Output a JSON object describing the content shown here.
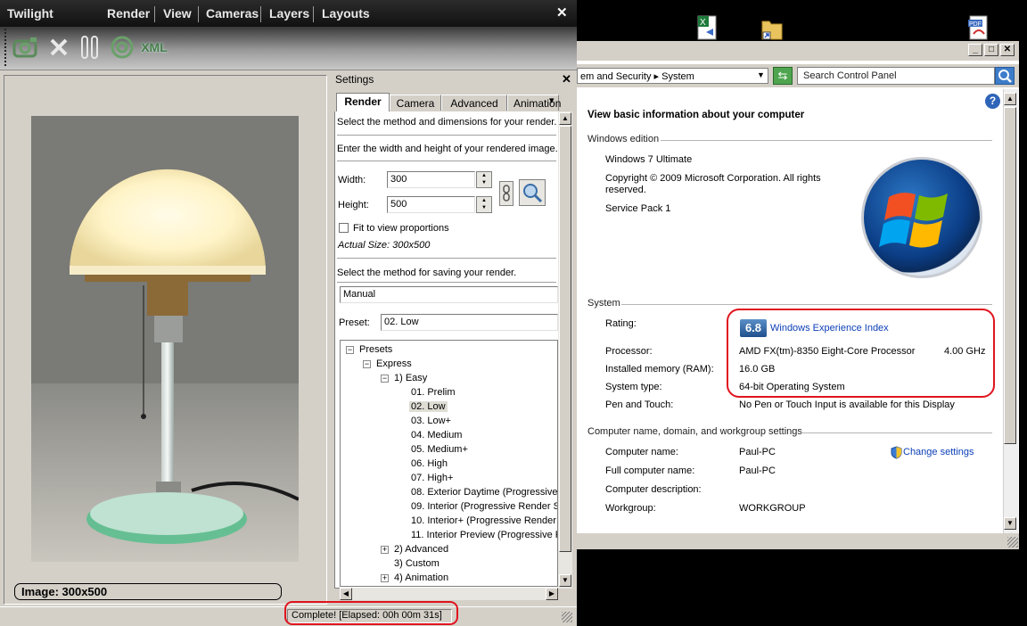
{
  "twilight": {
    "title": "Twilight",
    "menu": [
      "Render",
      "View",
      "Cameras",
      "Layers",
      "Layouts"
    ],
    "close_glyph": "✕",
    "toolbar": [
      {
        "icon": "camera-render-icon"
      },
      {
        "icon": "cancel-x-icon"
      },
      {
        "icon": "pause-icon"
      },
      {
        "icon": "target-icon"
      },
      {
        "icon": "xml-icon",
        "label": "XML"
      }
    ],
    "image_label": "Image: 300x500",
    "status": "Complete!  [Elapsed: 00h 00m 31s]"
  },
  "settings": {
    "title": "Settings",
    "close_glyph": "✕",
    "tabs": [
      "Render",
      "Camera",
      "Advanced",
      "Animation"
    ],
    "tab_arrow": "▾",
    "method_text": "Select the method and dimensions for your render.",
    "dims_text": "Enter the width and height of your rendered image.",
    "width_label": "Width:",
    "width_value": "300",
    "height_label": "Height:",
    "height_value": "500",
    "fit_label": "Fit to view proportions",
    "actual_size": "Actual Size: 300x500",
    "save_text": "Select the method for saving your render.",
    "save_method": "Manual",
    "preset_label": "Preset:",
    "preset_value": "02. Low",
    "tree": {
      "root": "Presets",
      "express": "Express",
      "easy": "1) Easy",
      "easy_items": [
        "01. Prelim",
        "02. Low",
        "03. Low+",
        "04. Medium",
        "05. Medium+",
        "06. High",
        "07. High+",
        "08. Exterior Daytime (Progressive",
        "09. Interior (Progressive Render S",
        "10. Interior+ (Progressive Render",
        "11. Interior Preview (Progressive F"
      ],
      "advanced": "2) Advanced",
      "custom": "3) Custom",
      "animation": "4) Animation"
    }
  },
  "control_panel": {
    "breadcrumb": "em and Security  ▸  System",
    "search_placeholder": "Search Control Panel",
    "heading": "View basic information about your computer",
    "windows_edition": {
      "title": "Windows edition",
      "edition": "Windows 7 Ultimate",
      "copyright": "Copyright © 2009 Microsoft Corporation.  All rights reserved.",
      "service_pack": "Service Pack 1"
    },
    "system": {
      "title": "System",
      "rating_label": "Rating:",
      "rating_value": "6.8",
      "rating_link": "Windows Experience Index",
      "processor_label": "Processor:",
      "processor_value": "AMD FX(tm)-8350 Eight-Core Processor",
      "processor_speed": "4.00 GHz",
      "memory_label": "Installed memory (RAM):",
      "memory_value": "16.0 GB",
      "type_label": "System type:",
      "type_value": "64-bit Operating System",
      "pen_label": "Pen and Touch:",
      "pen_value": "No Pen or Touch Input is available for this Display"
    },
    "computer": {
      "title": "Computer name, domain, and workgroup settings",
      "name_label": "Computer name:",
      "name_value": "Paul-PC",
      "full_label": "Full computer name:",
      "full_value": "Paul-PC",
      "desc_label": "Computer description:",
      "workgroup_label": "Workgroup:",
      "workgroup_value": "WORKGROUP",
      "change_link": "Change settings"
    }
  },
  "colors": {
    "highlight_red": "#e0141e",
    "link_blue": "#0b3fb7"
  }
}
